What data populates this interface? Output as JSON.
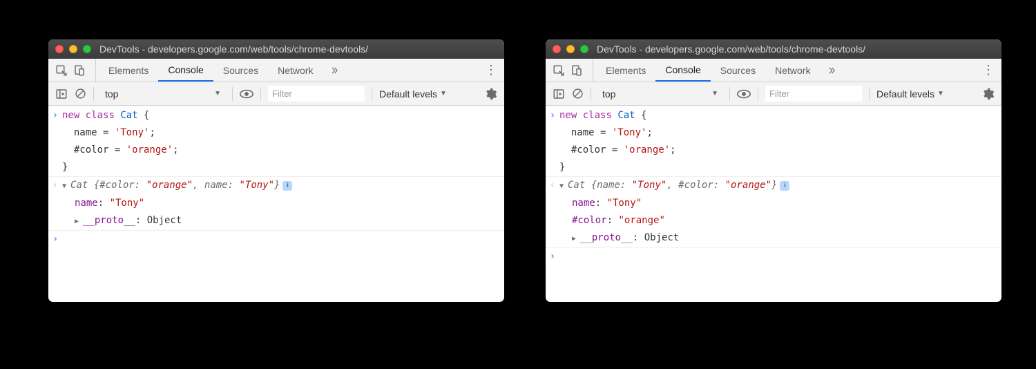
{
  "window_title": "DevTools - developers.google.com/web/tools/chrome-devtools/",
  "tabs": {
    "elements": "Elements",
    "console": "Console",
    "sources": "Sources",
    "network": "Network"
  },
  "toolbar": {
    "context": "top",
    "filter_placeholder": "Filter",
    "levels": "Default levels"
  },
  "code": {
    "kw_new": "new",
    "kw_class": "class",
    "classname": "Cat",
    "brace_open": " {",
    "line2a": "  name = ",
    "line2b": "'Tony'",
    "line2c": ";",
    "line3a": "  #color = ",
    "line3b": "'orange'",
    "line3c": ";",
    "brace_close": "}"
  },
  "left": {
    "summary_cls": "Cat ",
    "summary_open": "{",
    "summary_k1": "#color",
    "summary_sep1": ": ",
    "summary_v1": "\"orange\"",
    "summary_comma": ", ",
    "summary_k2": "name",
    "summary_sep2": ": ",
    "summary_v2": "\"Tony\"",
    "summary_close": "}",
    "expand_k1": "name",
    "expand_sep1": ": ",
    "expand_v1": "\"Tony\"",
    "proto_key": "__proto__",
    "proto_sep": ": ",
    "proto_val": "Object"
  },
  "right": {
    "summary_cls": "Cat ",
    "summary_open": "{",
    "summary_k1": "name",
    "summary_sep1": ": ",
    "summary_v1": "\"Tony\"",
    "summary_comma": ", ",
    "summary_k2": "#color",
    "summary_sep2": ": ",
    "summary_v2": "\"orange\"",
    "summary_close": "}",
    "expand_k1": "name",
    "expand_sep1": ": ",
    "expand_v1": "\"Tony\"",
    "expand_k2": "#color",
    "expand_sep2": ": ",
    "expand_v2": "\"orange\"",
    "proto_key": "__proto__",
    "proto_sep": ": ",
    "proto_val": "Object"
  },
  "info_badge": "i"
}
